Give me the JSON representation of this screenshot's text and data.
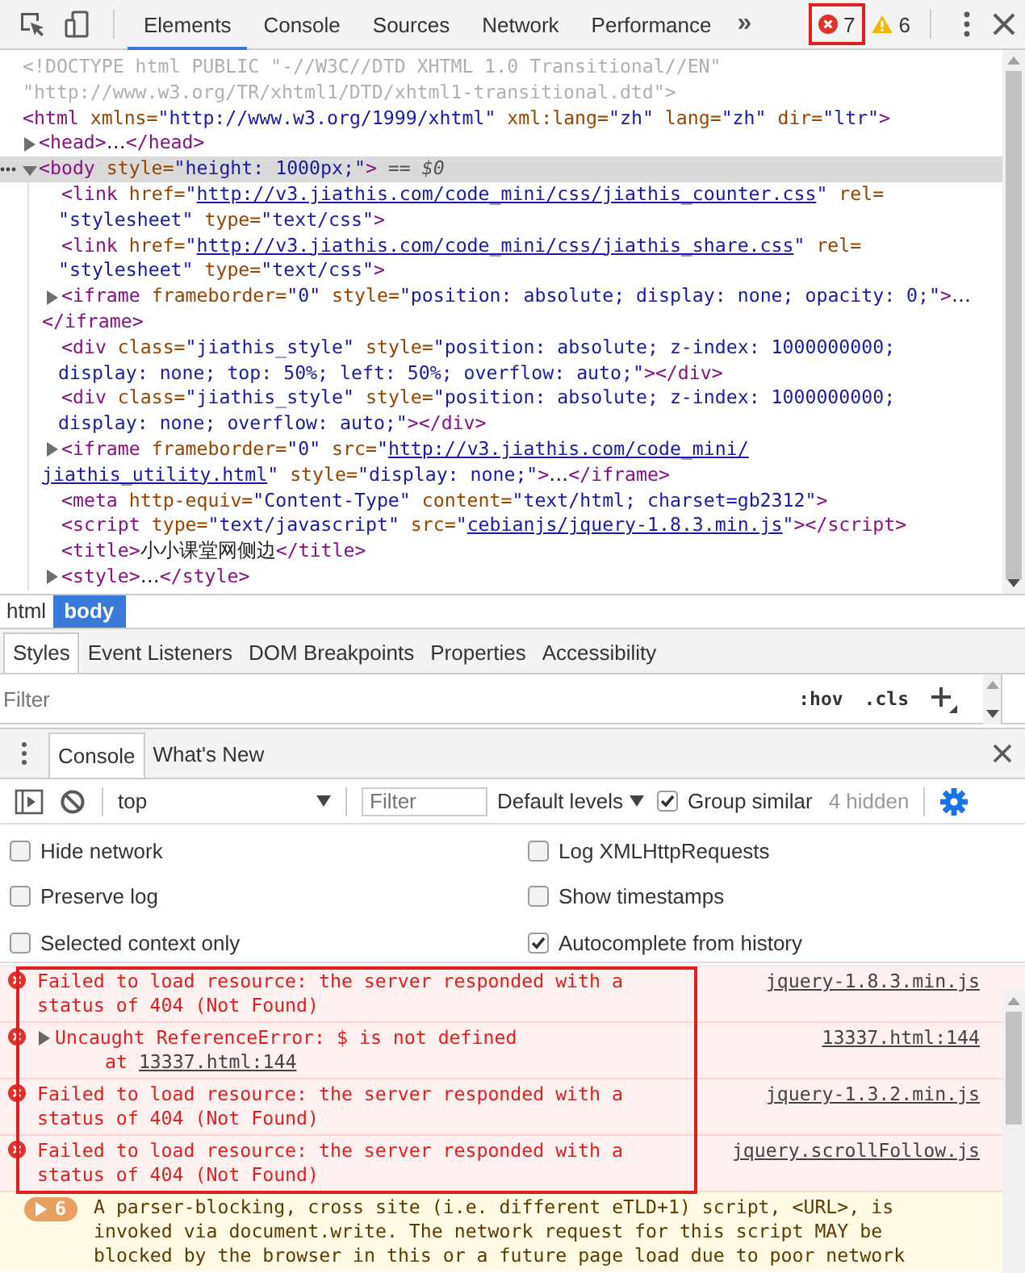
{
  "toolbar": {
    "tabs": [
      {
        "label": "Elements",
        "selected": true
      },
      {
        "label": "Console",
        "selected": false
      },
      {
        "label": "Sources",
        "selected": false
      },
      {
        "label": "Network",
        "selected": false
      },
      {
        "label": "Performance",
        "selected": false
      }
    ],
    "more": "»",
    "errors": {
      "count": "7",
      "annotated": true
    },
    "warnings": {
      "count": "6"
    }
  },
  "dom": {
    "nodes": [
      {
        "lines": [
          [
            {
              "kind": "doctype",
              "text": "<!DOCTYPE html PUBLIC \"-//W3C//DTD XHTML 1.0 Transitional//EN\""
            }
          ],
          [
            {
              "kind": "doctype",
              "text": "\"http://www.w3.org/TR/xhtml1/DTD/xhtml1-transitional.dtd\">"
            }
          ]
        ]
      },
      {
        "lines": [
          [
            {
              "kind": "tag",
              "text": "<html"
            },
            {
              "kind": "attr",
              "text": " xmlns="
            },
            {
              "kind": "val",
              "text": "\"http://www.w3.org/1999/xhtml\""
            },
            {
              "kind": "attr",
              "text": " xml:lang="
            },
            {
              "kind": "val",
              "text": "\"zh\""
            },
            {
              "kind": "attr",
              "text": " lang="
            },
            {
              "kind": "val",
              "text": "\"zh\""
            },
            {
              "kind": "attr",
              "text": " dir="
            },
            {
              "kind": "val",
              "text": "\"ltr\""
            },
            {
              "kind": "tag",
              "text": ">"
            }
          ]
        ],
        "children": [
          {
            "expanded": false,
            "lines": [
              [
                {
                  "kind": "tag",
                  "text": "<head>"
                },
                {
                  "kind": "text",
                  "text": "…"
                },
                {
                  "kind": "tag",
                  "text": "</head>"
                }
              ]
            ]
          },
          {
            "expanded": true,
            "selected": true,
            "lines": [
              [
                {
                  "kind": "tag",
                  "text": "<body"
                },
                {
                  "kind": "attr",
                  "text": " style="
                },
                {
                  "kind": "val",
                  "text": "\"height: 1000px;\""
                },
                {
                  "kind": "tag",
                  "text": ">"
                },
                {
                  "kind": "hint",
                  "text": " == $0"
                }
              ]
            ],
            "children": [
              {
                "lines": [
                  [
                    {
                      "kind": "tag",
                      "text": "<link"
                    },
                    {
                      "kind": "attr",
                      "text": " href="
                    },
                    {
                      "kind": "val",
                      "text": "\""
                    },
                    {
                      "kind": "link",
                      "text": "http://v3.jiathis.com/code_mini/css/jiathis_counter.css"
                    },
                    {
                      "kind": "val",
                      "text": "\""
                    },
                    {
                      "kind": "attr",
                      "text": " rel="
                    }
                  ],
                  [
                    {
                      "kind": "val",
                      "text": "\"stylesheet\""
                    },
                    {
                      "kind": "attr",
                      "text": " type="
                    },
                    {
                      "kind": "val",
                      "text": "\"text/css\""
                    },
                    {
                      "kind": "tag",
                      "text": ">"
                    }
                  ]
                ]
              },
              {
                "lines": [
                  [
                    {
                      "kind": "tag",
                      "text": "<link"
                    },
                    {
                      "kind": "attr",
                      "text": " href="
                    },
                    {
                      "kind": "val",
                      "text": "\""
                    },
                    {
                      "kind": "link",
                      "text": "http://v3.jiathis.com/code_mini/css/jiathis_share.css"
                    },
                    {
                      "kind": "val",
                      "text": "\""
                    },
                    {
                      "kind": "attr",
                      "text": " rel="
                    }
                  ],
                  [
                    {
                      "kind": "val",
                      "text": "\"stylesheet\""
                    },
                    {
                      "kind": "attr",
                      "text": " type="
                    },
                    {
                      "kind": "val",
                      "text": "\"text/css\""
                    },
                    {
                      "kind": "tag",
                      "text": ">"
                    }
                  ]
                ]
              },
              {
                "expanded": false,
                "lines": [
                  [
                    {
                      "kind": "tag",
                      "text": "<iframe"
                    },
                    {
                      "kind": "attr",
                      "text": " frameborder="
                    },
                    {
                      "kind": "val",
                      "text": "\"0\""
                    },
                    {
                      "kind": "attr",
                      "text": " style="
                    },
                    {
                      "kind": "val",
                      "text": "\"position: absolute; display: none; opacity: 0;\""
                    },
                    {
                      "kind": "tag",
                      "text": ">"
                    },
                    {
                      "kind": "text",
                      "text": "…"
                    }
                  ],
                  [
                    {
                      "kind": "tag",
                      "text": "</iframe>"
                    }
                  ]
                ]
              },
              {
                "lines": [
                  [
                    {
                      "kind": "tag",
                      "text": "<div"
                    },
                    {
                      "kind": "attr",
                      "text": " class="
                    },
                    {
                      "kind": "val",
                      "text": "\"jiathis_style\""
                    },
                    {
                      "kind": "attr",
                      "text": " style="
                    },
                    {
                      "kind": "val",
                      "text": "\"position: absolute; z-index: 1000000000;"
                    }
                  ],
                  [
                    {
                      "kind": "val",
                      "text": "display: none; top: 50%; left: 50%; overflow: auto;\""
                    },
                    {
                      "kind": "tag",
                      "text": "></div>"
                    }
                  ]
                ]
              },
              {
                "lines": [
                  [
                    {
                      "kind": "tag",
                      "text": "<div"
                    },
                    {
                      "kind": "attr",
                      "text": " class="
                    },
                    {
                      "kind": "val",
                      "text": "\"jiathis_style\""
                    },
                    {
                      "kind": "attr",
                      "text": " style="
                    },
                    {
                      "kind": "val",
                      "text": "\"position: absolute; z-index: 1000000000;"
                    }
                  ],
                  [
                    {
                      "kind": "val",
                      "text": "display: none; overflow: auto;\""
                    },
                    {
                      "kind": "tag",
                      "text": "></div>"
                    }
                  ]
                ]
              },
              {
                "expanded": false,
                "lines": [
                  [
                    {
                      "kind": "tag",
                      "text": "<iframe"
                    },
                    {
                      "kind": "attr",
                      "text": " frameborder="
                    },
                    {
                      "kind": "val",
                      "text": "\"0\""
                    },
                    {
                      "kind": "attr",
                      "text": " src="
                    },
                    {
                      "kind": "val",
                      "text": "\""
                    },
                    {
                      "kind": "link",
                      "text": "http://v3.jiathis.com/code_mini/"
                    }
                  ],
                  [
                    {
                      "kind": "link",
                      "text": "jiathis_utility.html"
                    },
                    {
                      "kind": "val",
                      "text": "\""
                    },
                    {
                      "kind": "attr",
                      "text": " style="
                    },
                    {
                      "kind": "val",
                      "text": "\"display: none;\""
                    },
                    {
                      "kind": "tag",
                      "text": ">"
                    },
                    {
                      "kind": "text",
                      "text": "…"
                    },
                    {
                      "kind": "tag",
                      "text": "</iframe>"
                    }
                  ]
                ]
              },
              {
                "lines": [
                  [
                    {
                      "kind": "tag",
                      "text": "<meta"
                    },
                    {
                      "kind": "attr",
                      "text": " http-equiv="
                    },
                    {
                      "kind": "val",
                      "text": "\"Content-Type\""
                    },
                    {
                      "kind": "attr",
                      "text": " content="
                    },
                    {
                      "kind": "val",
                      "text": "\"text/html; charset=gb2312\""
                    },
                    {
                      "kind": "tag",
                      "text": ">"
                    }
                  ]
                ]
              },
              {
                "lines": [
                  [
                    {
                      "kind": "tag",
                      "text": "<script"
                    },
                    {
                      "kind": "attr",
                      "text": " type="
                    },
                    {
                      "kind": "val",
                      "text": "\"text/javascript\""
                    },
                    {
                      "kind": "attr",
                      "text": " src="
                    },
                    {
                      "kind": "val",
                      "text": "\""
                    },
                    {
                      "kind": "link",
                      "text": "cebianjs/jquery-1.8.3.min.js"
                    },
                    {
                      "kind": "val",
                      "text": "\""
                    },
                    {
                      "kind": "tag",
                      "text": "></script>"
                    }
                  ]
                ]
              },
              {
                "lines": [
                  [
                    {
                      "kind": "tag",
                      "text": "<title>"
                    },
                    {
                      "kind": "text",
                      "text": "小小课堂网侧边"
                    },
                    {
                      "kind": "tag",
                      "text": "</title>"
                    }
                  ]
                ]
              },
              {
                "expanded": false,
                "lines": [
                  [
                    {
                      "kind": "tag",
                      "text": "<style>"
                    },
                    {
                      "kind": "text",
                      "text": "…"
                    },
                    {
                      "kind": "tag",
                      "text": "</style>"
                    }
                  ]
                ]
              }
            ]
          }
        ]
      }
    ]
  },
  "breadcrumbs": [
    {
      "label": "html",
      "selected": false
    },
    {
      "label": "body",
      "selected": true
    }
  ],
  "sidebar": {
    "tabs": [
      {
        "label": "Styles",
        "selected": true
      },
      {
        "label": "Event Listeners",
        "selected": false
      },
      {
        "label": "DOM Breakpoints",
        "selected": false
      },
      {
        "label": "Properties",
        "selected": false
      },
      {
        "label": "Accessibility",
        "selected": false
      }
    ],
    "filter": {
      "placeholder": "Filter"
    },
    "hov": ":hov",
    "cls": ".cls"
  },
  "drawer": {
    "tabs": [
      {
        "label": "Console",
        "selected": true
      },
      {
        "label": "What's New",
        "selected": false
      }
    ]
  },
  "console": {
    "context": "top",
    "filter": {
      "placeholder": "Filter"
    },
    "levels": "Default levels",
    "group_similar": {
      "label": "Group similar",
      "checked": true
    },
    "hidden": "4 hidden",
    "settings": [
      {
        "label": "Hide network",
        "checked": false
      },
      {
        "label": "Log XMLHttpRequests",
        "checked": false
      },
      {
        "label": "Preserve log",
        "checked": false
      },
      {
        "label": "Show timestamps",
        "checked": false
      },
      {
        "label": "Selected context only",
        "checked": false
      },
      {
        "label": "Autocomplete from history",
        "checked": true
      }
    ],
    "annotated": true,
    "messages": [
      {
        "kind": "error",
        "lines": [
          "Failed to load resource: the server responded with a",
          "status of 404 (Not Found)"
        ],
        "source": "jquery-1.8.3.min.js"
      },
      {
        "kind": "error",
        "expanded": false,
        "lines": [
          "Uncaught ReferenceError: $ is not defined"
        ],
        "stack_prefix": "at",
        "stack_link": "13337.html:144",
        "source": "13337.html:144"
      },
      {
        "kind": "error",
        "lines": [
          "Failed to load resource: the server responded with a",
          "status of 404 (Not Found)"
        ],
        "source": "jquery-1.3.2.min.js"
      },
      {
        "kind": "error",
        "lines": [
          "Failed to load resource: the server responded with a",
          "status of 404 (Not Found)"
        ],
        "source": "jquery.scrollFollow.js"
      },
      {
        "kind": "warning",
        "count": "6",
        "lines": [
          "A parser-blocking, cross site (i.e. different eTLD+1) script, <URL>, is",
          "invoked via document.write. The network request for this script MAY be",
          "blocked by the browser in this or a future page load due to poor network"
        ]
      }
    ]
  }
}
